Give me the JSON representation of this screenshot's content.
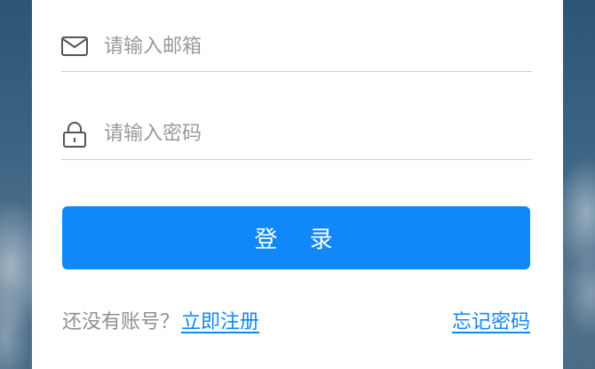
{
  "form": {
    "email_placeholder": "请输入邮箱",
    "password_placeholder": "请输入密码",
    "login_label": "登 录",
    "no_account_prompt": "还没有账号？",
    "register_link": "立即注册 ",
    "forgot_password_link": "忘记密码"
  },
  "icons": {
    "email": "mail-icon",
    "password": "lock-icon"
  },
  "colors": {
    "accent": "#1188f7",
    "placeholder": "#9a9a9a",
    "divider": "#cfcfcf",
    "card_background": "#ffffff",
    "page_background": "#3f6784"
  }
}
